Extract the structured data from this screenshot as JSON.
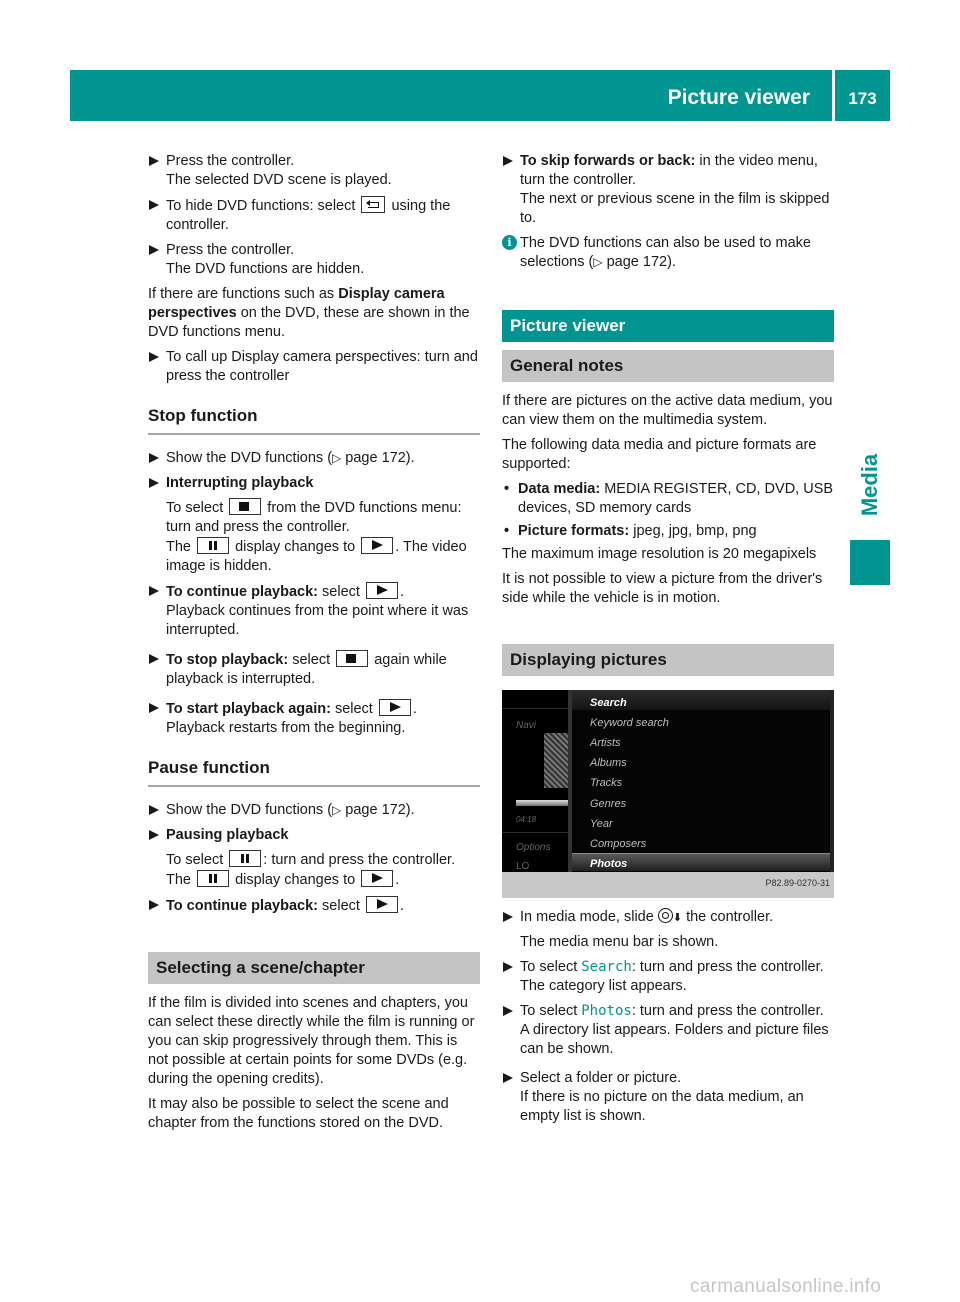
{
  "header": {
    "section_title": "Picture viewer",
    "page_number": "173",
    "side_tab": "Media"
  },
  "left_column": {
    "steps_intro": [
      {
        "text": "Press the controller.",
        "result": "The selected DVD scene is played."
      },
      {
        "text_before": "To hide DVD functions: select",
        "icon": "back-icon",
        "text_after": "using the controller."
      },
      {
        "text": "Press the controller.",
        "result": "The DVD functions are hidden."
      }
    ],
    "para_camera": {
      "before": "If there are functions such as ",
      "bold": "Display camera perspectives",
      "after": " on the DVD, these are shown in the DVD functions menu."
    },
    "step_camera": "To call up Display camera perspectives: turn and press the controller",
    "stop_function": {
      "heading": "Stop function",
      "show": {
        "text": "Show the DVD functions (",
        "ref_symbol": "▷",
        "ref": " page 172)."
      },
      "interrupting": {
        "label": "Interrupting playback",
        "line1_before": "To select",
        "line1_after": "from the DVD functions menu: turn and press the controller.",
        "line2_before": "The",
        "line2_mid": "display changes to",
        "line2_after": ". The video image is hidden."
      },
      "continue": {
        "label": "To continue playback:",
        "before": " select",
        "after": ".",
        "result": "Playback continues from the point where it was interrupted."
      },
      "stop": {
        "label": "To stop playback:",
        "before": " select",
        "after": "again while playback is interrupted."
      },
      "restart": {
        "label": "To start playback again:",
        "before": " select",
        "after": ".",
        "result": "Playback restarts from the beginning."
      }
    },
    "pause_function": {
      "heading": "Pause function",
      "show": {
        "text": "Show the DVD functions (",
        "ref_symbol": "▷",
        "ref": " page 172)."
      },
      "pausing": {
        "label": "Pausing playback",
        "line1_before": "To select",
        "line1_after": ": turn and press the controller.",
        "line2_before": "The",
        "line2_mid": "display changes to",
        "line2_after": "."
      },
      "continue": {
        "label": "To continue playback:",
        "before": " select",
        "after": "."
      }
    },
    "scene_chapter": {
      "heading": "Selecting a scene/chapter",
      "para1": "If the film is divided into scenes and chapters, you can select these directly while the film is running or you can skip progressively through them. This is not possible at certain points for some DVDs (e.g. during the opening credits).",
      "para2": "It may also be possible to select the scene and chapter from the functions stored on the DVD."
    }
  },
  "right_column": {
    "skip": {
      "label": "To skip forwards or back:",
      "text": " in the video menu, turn the controller.",
      "result": "The next or previous scene in the film is skipped to."
    },
    "info_note": {
      "text": "The DVD functions can also be used to make selections (",
      "ref_symbol": "▷",
      "ref": " page 172)."
    },
    "picture_viewer_heading": "Picture viewer",
    "general_notes": {
      "heading": "General notes",
      "para1": "If there are pictures on the active data medium, you can view them on the multimedia system.",
      "para2": "The following data media and picture formats are supported:",
      "bullets": [
        {
          "label": "Data media:",
          "text": " MEDIA REGISTER, CD, DVD, USB devices, SD memory cards"
        },
        {
          "label": "Picture formats:",
          "text": " jpeg, jpg, bmp, png"
        }
      ],
      "para3": "The maximum image resolution is 20 megapixels",
      "para4": "It is not possible to view a picture from the driver's side while the vehicle is in motion."
    },
    "displaying_pictures": {
      "heading": "Displaying pictures",
      "screenshot": {
        "left_pane": {
          "navi": "Navi",
          "time": "04:18",
          "options": "Options",
          "lo": "LO"
        },
        "menu_items": [
          "Search",
          "Keyword search",
          "Artists",
          "Albums",
          "Tracks",
          "Genres",
          "Year",
          "Composers",
          "Photos"
        ],
        "selected_item": "Photos",
        "figure_code": "P82.89-0270-31"
      },
      "steps": [
        {
          "before": "In media mode, slide ",
          "icon": "controller-slide-down-icon",
          "after": " the controller.",
          "result": "The media menu bar is shown."
        },
        {
          "before": "To select ",
          "highlight": "Search",
          "after": ": turn and press the controller.",
          "result": "The category list appears."
        },
        {
          "before": "To select ",
          "highlight": "Photos",
          "after": ": turn and press the controller.",
          "result": "A directory list appears. Folders and picture files can be shown."
        },
        {
          "text": "Select a folder or picture.",
          "result": "If there is no picture on the data medium, an empty list is shown."
        }
      ]
    }
  },
  "watermark": "carmanualsonline.info",
  "colors": {
    "accent": "#009591",
    "heading_grey": "#c4c4c4"
  }
}
